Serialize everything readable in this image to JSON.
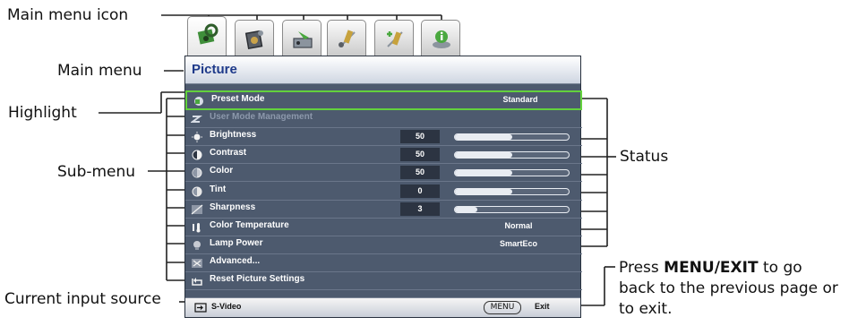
{
  "callouts": {
    "main_menu_icon": "Main menu icon",
    "main_menu": "Main menu",
    "highlight": "Highlight",
    "sub_menu": "Sub-menu",
    "current_input_source": "Current input source",
    "status": "Status",
    "press_prefix": "Press ",
    "press_key": "MENU/EXIT",
    "press_suffix": " to go",
    "press_line2": "back to the previous page or",
    "press_line3": "to exit."
  },
  "tabs": [
    {
      "icon": "picture-icon",
      "active": true
    },
    {
      "icon": "display-icon",
      "active": false
    },
    {
      "icon": "installation-icon",
      "active": false
    },
    {
      "icon": "system-setup-basic-icon",
      "active": false
    },
    {
      "icon": "system-setup-advanced-icon",
      "active": false
    },
    {
      "icon": "information-icon",
      "active": false
    }
  ],
  "osd": {
    "title": "Picture",
    "rows": [
      {
        "label": "Preset Mode",
        "value": "Standard",
        "icon": "preset-mode-icon",
        "highlight": true
      },
      {
        "label": "User Mode Management",
        "icon": "user-mode-icon",
        "dim": true
      },
      {
        "label": "Brightness",
        "num": "50",
        "level": 0.5,
        "icon": "brightness-icon"
      },
      {
        "label": "Contrast",
        "num": "50",
        "level": 0.5,
        "icon": "contrast-icon"
      },
      {
        "label": "Color",
        "num": "50",
        "level": 0.5,
        "icon": "color-icon"
      },
      {
        "label": "Tint",
        "num": "0",
        "level": 0.5,
        "icon": "tint-icon"
      },
      {
        "label": "Sharpness",
        "num": "3",
        "level": 0.2,
        "icon": "sharpness-icon"
      },
      {
        "label": "Color Temperature",
        "value": "Normal",
        "icon": "color-temperature-icon"
      },
      {
        "label": "Lamp Power",
        "value": "SmartEco",
        "icon": "lamp-power-icon"
      },
      {
        "label": "Advanced...",
        "icon": "advanced-icon"
      },
      {
        "label": "Reset Picture Settings",
        "icon": "reset-icon"
      }
    ],
    "source": "S-Video",
    "menu_button": "MENU",
    "exit_label": "Exit"
  },
  "colors": {
    "panel": "#4d5a6e",
    "highlight": "#63d13d",
    "title": "#1e3a8a"
  }
}
